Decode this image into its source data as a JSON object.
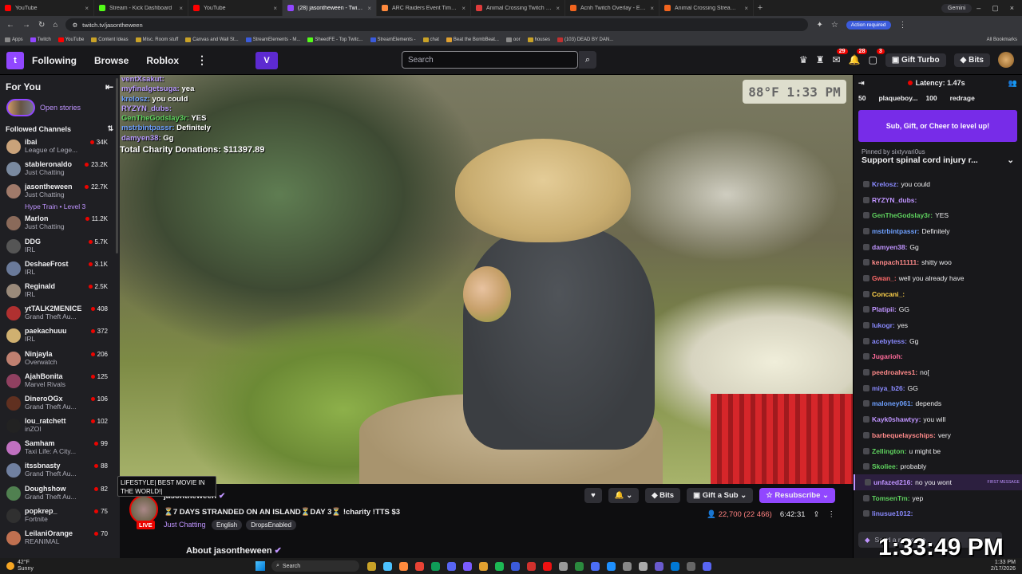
{
  "browser": {
    "tabs": [
      {
        "title": "YouTube",
        "color": "#ff0000"
      },
      {
        "title": "Stream - Kick Dashboard",
        "color": "#53fc18"
      },
      {
        "title": "YouTube",
        "color": "#ff0000"
      },
      {
        "title": "(28) jasontheween - Twitch",
        "color": "#9147ff",
        "active": true
      },
      {
        "title": "ARC Raiders Event Timers | Me",
        "color": "#ff8a3d"
      },
      {
        "title": "Animal Crossing Twitch Overlay",
        "color": "#e03b3b"
      },
      {
        "title": "Acnh Twitch Overlay - Etsy",
        "color": "#f1641e"
      },
      {
        "title": "Animal Crossing Stream Overlay",
        "color": "#f1641e"
      }
    ],
    "new_tab": "+",
    "gemini": "Gemini",
    "url": "twitch.tv/jasontheween",
    "action_required": "Action required",
    "bookmarks": [
      "Apps",
      "Twitch",
      "YouTube",
      "Content Ideas",
      "Misc. Room stuff",
      "Canvas and Wall St...",
      "StreamElements - M...",
      "SheedFE - Top Twitc...",
      "StreamElements -",
      "chat",
      "Beat the BombBeat...",
      "oor",
      "houses",
      "(103) DEAD BY DAN..."
    ],
    "all_bookmarks": "All Bookmarks"
  },
  "twitch_nav": {
    "following": "Following",
    "browse": "Browse",
    "roblox": "Roblox",
    "more": "⋮",
    "search_placeholder": "Search",
    "notif_counts": [
      "29",
      "28",
      "3"
    ],
    "gift_turbo": "Gift Turbo",
    "bits": "Bits"
  },
  "sidebar": {
    "for_you": "For You",
    "open_stories": "Open stories",
    "followed_channels": "Followed Channels",
    "channels": [
      {
        "name": "ibai",
        "game": "League of Lege...",
        "viewers": "34K",
        "color": "#c9a27a"
      },
      {
        "name": "stableronaldo",
        "game": "Just Chatting",
        "viewers": "23.2K",
        "color": "#7a8aa0"
      },
      {
        "name": "jasontheween",
        "game": "Just Chatting",
        "viewers": "22.7K",
        "color": "#a07a6a",
        "hype": "Hype Train • Level 3"
      },
      {
        "name": "Marlon",
        "game": "Just Chatting",
        "viewers": "11.2K",
        "color": "#8a6a5a"
      },
      {
        "name": "DDG",
        "game": "IRL",
        "viewers": "5.7K",
        "color": "#555"
      },
      {
        "name": "DeshaeFrost",
        "game": "IRL",
        "viewers": "3.1K",
        "color": "#6a7a9a"
      },
      {
        "name": "Reginald",
        "game": "IRL",
        "viewers": "2.5K",
        "color": "#9a8a7a"
      },
      {
        "name": "ytTALK2MENICE",
        "game": "Grand Theft Au...",
        "viewers": "408",
        "color": "#b03030"
      },
      {
        "name": "paekachuuu",
        "game": "IRL",
        "viewers": "372",
        "color": "#d0b070"
      },
      {
        "name": "Ninjayla",
        "game": "Overwatch",
        "viewers": "206",
        "color": "#c08070"
      },
      {
        "name": "AjahBonita",
        "game": "Marvel Rivals",
        "viewers": "125",
        "color": "#904060"
      },
      {
        "name": "DineroOGx",
        "game": "Grand Theft Au...",
        "viewers": "106",
        "color": "#603020"
      },
      {
        "name": "lou_ratchett",
        "game": "inZOI",
        "viewers": "102",
        "color": "#222"
      },
      {
        "name": "Samham",
        "game": "Taxi Life: A City...",
        "viewers": "99",
        "color": "#c070c0"
      },
      {
        "name": "itssbnasty",
        "game": "Grand Theft Au...",
        "viewers": "88",
        "color": "#7080a0"
      },
      {
        "name": "Doughshow",
        "game": "Grand Theft Au...",
        "viewers": "82",
        "color": "#508050"
      },
      {
        "name": "popkrep_",
        "game": "Fortnite",
        "viewers": "75",
        "color": "#303030"
      },
      {
        "name": "LeilaniOrange",
        "game": "REANIMAL",
        "viewers": "70",
        "color": "#c07050"
      }
    ],
    "tooltip": "LIFESTYLE| BEST MOVIE IN THE WORLD!|"
  },
  "overlay": {
    "weather": "88°F  1:33 PM",
    "chat": [
      {
        "user": "ventXsakut:",
        "text": "",
        "c": "u"
      },
      {
        "user": "myfinalgetsuga:",
        "text": "yea",
        "c": "u"
      },
      {
        "user": "krelosz:",
        "text": "you could",
        "c": "b"
      },
      {
        "user": "RYZYN_dubs:",
        "text": "",
        "c": "u"
      },
      {
        "user": "GenTheGodslay3r:",
        "text": "YES",
        "c": "g"
      },
      {
        "user": "mstrbintpassr:",
        "text": "Definitely",
        "c": "b"
      },
      {
        "user": "damyen38:",
        "text": "Gg",
        "c": "u"
      }
    ],
    "donations": "Total Charity Donations: $11397.89"
  },
  "stream": {
    "channel": "jasontheween",
    "live": "LIVE",
    "title": "⏳7 DAYS STRANDED ON AN ISLAND⏳DAY 3⏳ !charity !TTS $3",
    "category": "Just Chatting",
    "tags": [
      "English",
      "DropsEnabled"
    ],
    "about": "About jasontheween",
    "buttons": {
      "bits": "Bits",
      "gift_sub": "Gift a Sub",
      "resubscribe": "Resubscribe"
    },
    "viewers": "22,700 (22 466)",
    "uptime": "6:42:31"
  },
  "chat": {
    "latency": "Latency: 1.47s",
    "board": [
      {
        "count": "50",
        "name": ""
      },
      {
        "count": "",
        "name": "plaqueboy..."
      },
      {
        "count": "100",
        "name": ""
      },
      {
        "count": "",
        "name": "redrage"
      }
    ],
    "sub_banner": "Sub, Gift, or Cheer to level up!",
    "pinned_by": "Pinned by  sixtyvari0us",
    "pinned": "Support spinal cord injury r...",
    "messages": [
      {
        "user": "Krelosz:",
        "text": "you could",
        "color": "#8a8aff"
      },
      {
        "user": "RYZYN_dubs:",
        "text": "",
        "color": "#bf94ff"
      },
      {
        "user": "GenTheGodslay3r:",
        "text": "YES",
        "color": "#5fd35f"
      },
      {
        "user": "mstrbintpassr:",
        "text": "Definitely",
        "color": "#6ea0ff"
      },
      {
        "user": "damyen38:",
        "text": "Gg",
        "color": "#bf94ff"
      },
      {
        "user": "kenpach11111:",
        "text": "shitty woo",
        "color": "#ff8a8a"
      },
      {
        "user": "Gwan_:",
        "text": "well you already have",
        "color": "#ff6a6a"
      },
      {
        "user": "Concani_:",
        "text": "",
        "color": "#ffd24a"
      },
      {
        "user": "Platipii:",
        "text": "GG",
        "color": "#bf94ff"
      },
      {
        "user": "lukogr:",
        "text": "yes",
        "color": "#8a8aff"
      },
      {
        "user": "acebytess:",
        "text": "Gg",
        "color": "#8a8aff"
      },
      {
        "user": "Jugarioh:",
        "text": "",
        "color": "#ff6a9a"
      },
      {
        "user": "peedroalves1:",
        "text": "no[",
        "color": "#ff8a8a"
      },
      {
        "user": "miya_b26:",
        "text": "GG",
        "color": "#8a8aff"
      },
      {
        "user": "maloney061:",
        "text": "depends",
        "color": "#6ea0ff"
      },
      {
        "user": "Kayk0shawtyy:",
        "text": "you will",
        "color": "#bf94ff"
      },
      {
        "user": "barbequelayschips:",
        "text": "very",
        "color": "#ff8a8a"
      },
      {
        "user": "Zellington:",
        "text": "u might be",
        "color": "#5fd35f"
      },
      {
        "user": "Skoliee:",
        "text": "probably",
        "color": "#5fd35f"
      },
      {
        "user": "unfazed216:",
        "text": "no you wont",
        "color": "#bf94ff",
        "first": true
      },
      {
        "user": "TomsenTm:",
        "text": "yep",
        "color": "#5fd35f"
      },
      {
        "user": "linusue1012:",
        "text": "",
        "color": "#8a8aff"
      }
    ],
    "first_message": "FIRST MESSAGE",
    "input_placeholder": "Send a message"
  },
  "clock_overlay": "1:33:49 PM",
  "taskbar": {
    "temp": "42°F",
    "cond": "Sunny",
    "search": "Search",
    "time": "1:33 PM",
    "date": "2/17/2026"
  }
}
